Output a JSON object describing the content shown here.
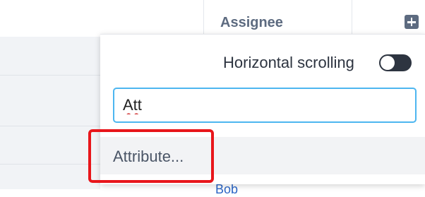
{
  "header": {
    "column_title": "Assignee",
    "add_column_icon": "plus-square-icon"
  },
  "below": {
    "partial_text": "Bob"
  },
  "panel": {
    "horizontal_scrolling_label": "Horizontal scrolling",
    "horizontal_scrolling_enabled": false,
    "search_value": "Att",
    "results": [
      {
        "label": "Attribute..."
      }
    ]
  },
  "colors": {
    "input_focus_border": "#4db6f0",
    "highlight": "#e8161b",
    "toggle_track": "#2d3440"
  }
}
